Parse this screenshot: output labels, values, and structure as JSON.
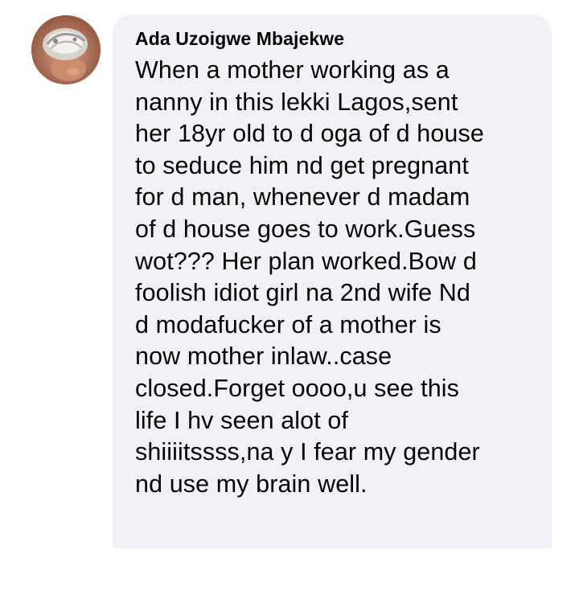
{
  "comment": {
    "author": "Ada Uzoigwe Mbajekwe",
    "avatar_icon": "profile-photo",
    "text": "When a mother working as a\nnanny in this lekki Lagos,sent\nher 18yr old to d oga of d house\nto seduce him nd get pregnant\nfor d man, whenever d madam\nof d house goes to work.Guess\nwot??? Her plan worked.Bow d\nfoolish idiot girl na 2nd wife Nd\nd modafucker of a mother is\nnow mother inlaw..case\nclosed.Forget oooo,u see this\nlife I hv seen alot of\nshiiiitssss,na y I fear my gender\nnd use my brain well.",
    "bubble_color": "#f0f2f5",
    "text_color": "#050505"
  }
}
